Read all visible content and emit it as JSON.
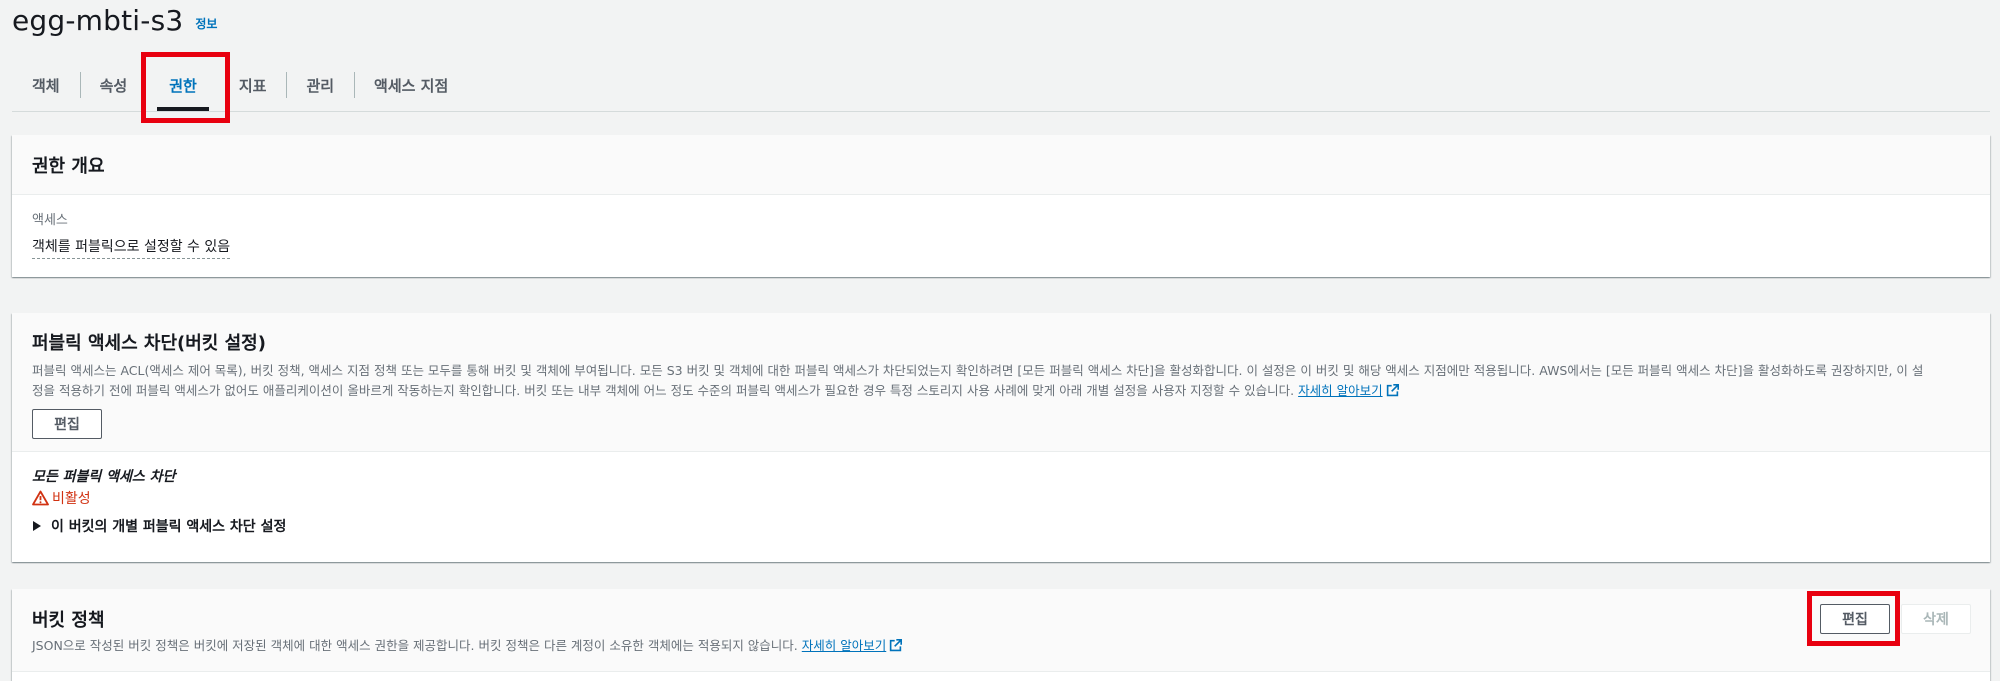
{
  "header": {
    "title": "egg-mbti-s3",
    "info": "정보"
  },
  "tabs": [
    {
      "label": "객체",
      "active": false
    },
    {
      "label": "속성",
      "active": false
    },
    {
      "label": "권한",
      "active": true
    },
    {
      "label": "지표",
      "active": false
    },
    {
      "label": "관리",
      "active": false
    },
    {
      "label": "액세스 지점",
      "active": false
    }
  ],
  "overview": {
    "title": "권한 개요",
    "access_label": "액세스",
    "access_value": "객체를 퍼블릭으로 설정할 수 있음"
  },
  "public_block": {
    "title": "퍼블릭 액세스 차단(버킷 설정)",
    "desc_line1": "퍼블릭 액세스는 ACL(액세스 제어 목록), 버킷 정책, 액세스 지점 정책 또는 모두를 통해 버킷 및 객체에 부여됩니다. 모든 S3 버킷 및 객체에 대한 퍼블릭 액세스가 차단되었는지 확인하려면 [모든 퍼블릭 액세스 차단]을 활성화합니다. 이 설정은 이 버킷 및 해당 액세스 지점에만 적용됩니다. AWS에서는 [모든 퍼블릭 액세스 차단]을 활성화하도록 권장하지만, 이 설",
    "desc_line2": "정을 적용하기 전에 퍼블릭 액세스가 없어도 애플리케이션이 올바르게 작동하는지 확인합니다. 버킷 또는 내부 객체에 어느 정도 수준의 퍼블릭 액세스가 필요한 경우 특정 스토리지 사용 사례에 맞게 아래 개별 설정을 사용자 지정할 수 있습니다.",
    "learn_more": "자세히 알아보기",
    "edit_label": "편집",
    "block_all_label": "모든 퍼블릭 액세스 차단",
    "status": "비활성",
    "expand_label": "이 버킷의 개별 퍼블릭 액세스 차단 설정",
    "status_color": "#d13212"
  },
  "bucket_policy": {
    "title": "버킷 정책",
    "desc": "JSON으로 작성된 버킷 정책은 버킷에 저장된 객체에 대한 액세스 권한을 제공합니다. 버킷 정책은 다른 계정이 소유한 객체에는 적용되지 않습니다.",
    "learn_more": "자세히 알아보기",
    "edit_label": "편집",
    "delete_label": "삭제"
  },
  "colors": {
    "accent": "#0073bb",
    "highlight": "#e8000f"
  }
}
